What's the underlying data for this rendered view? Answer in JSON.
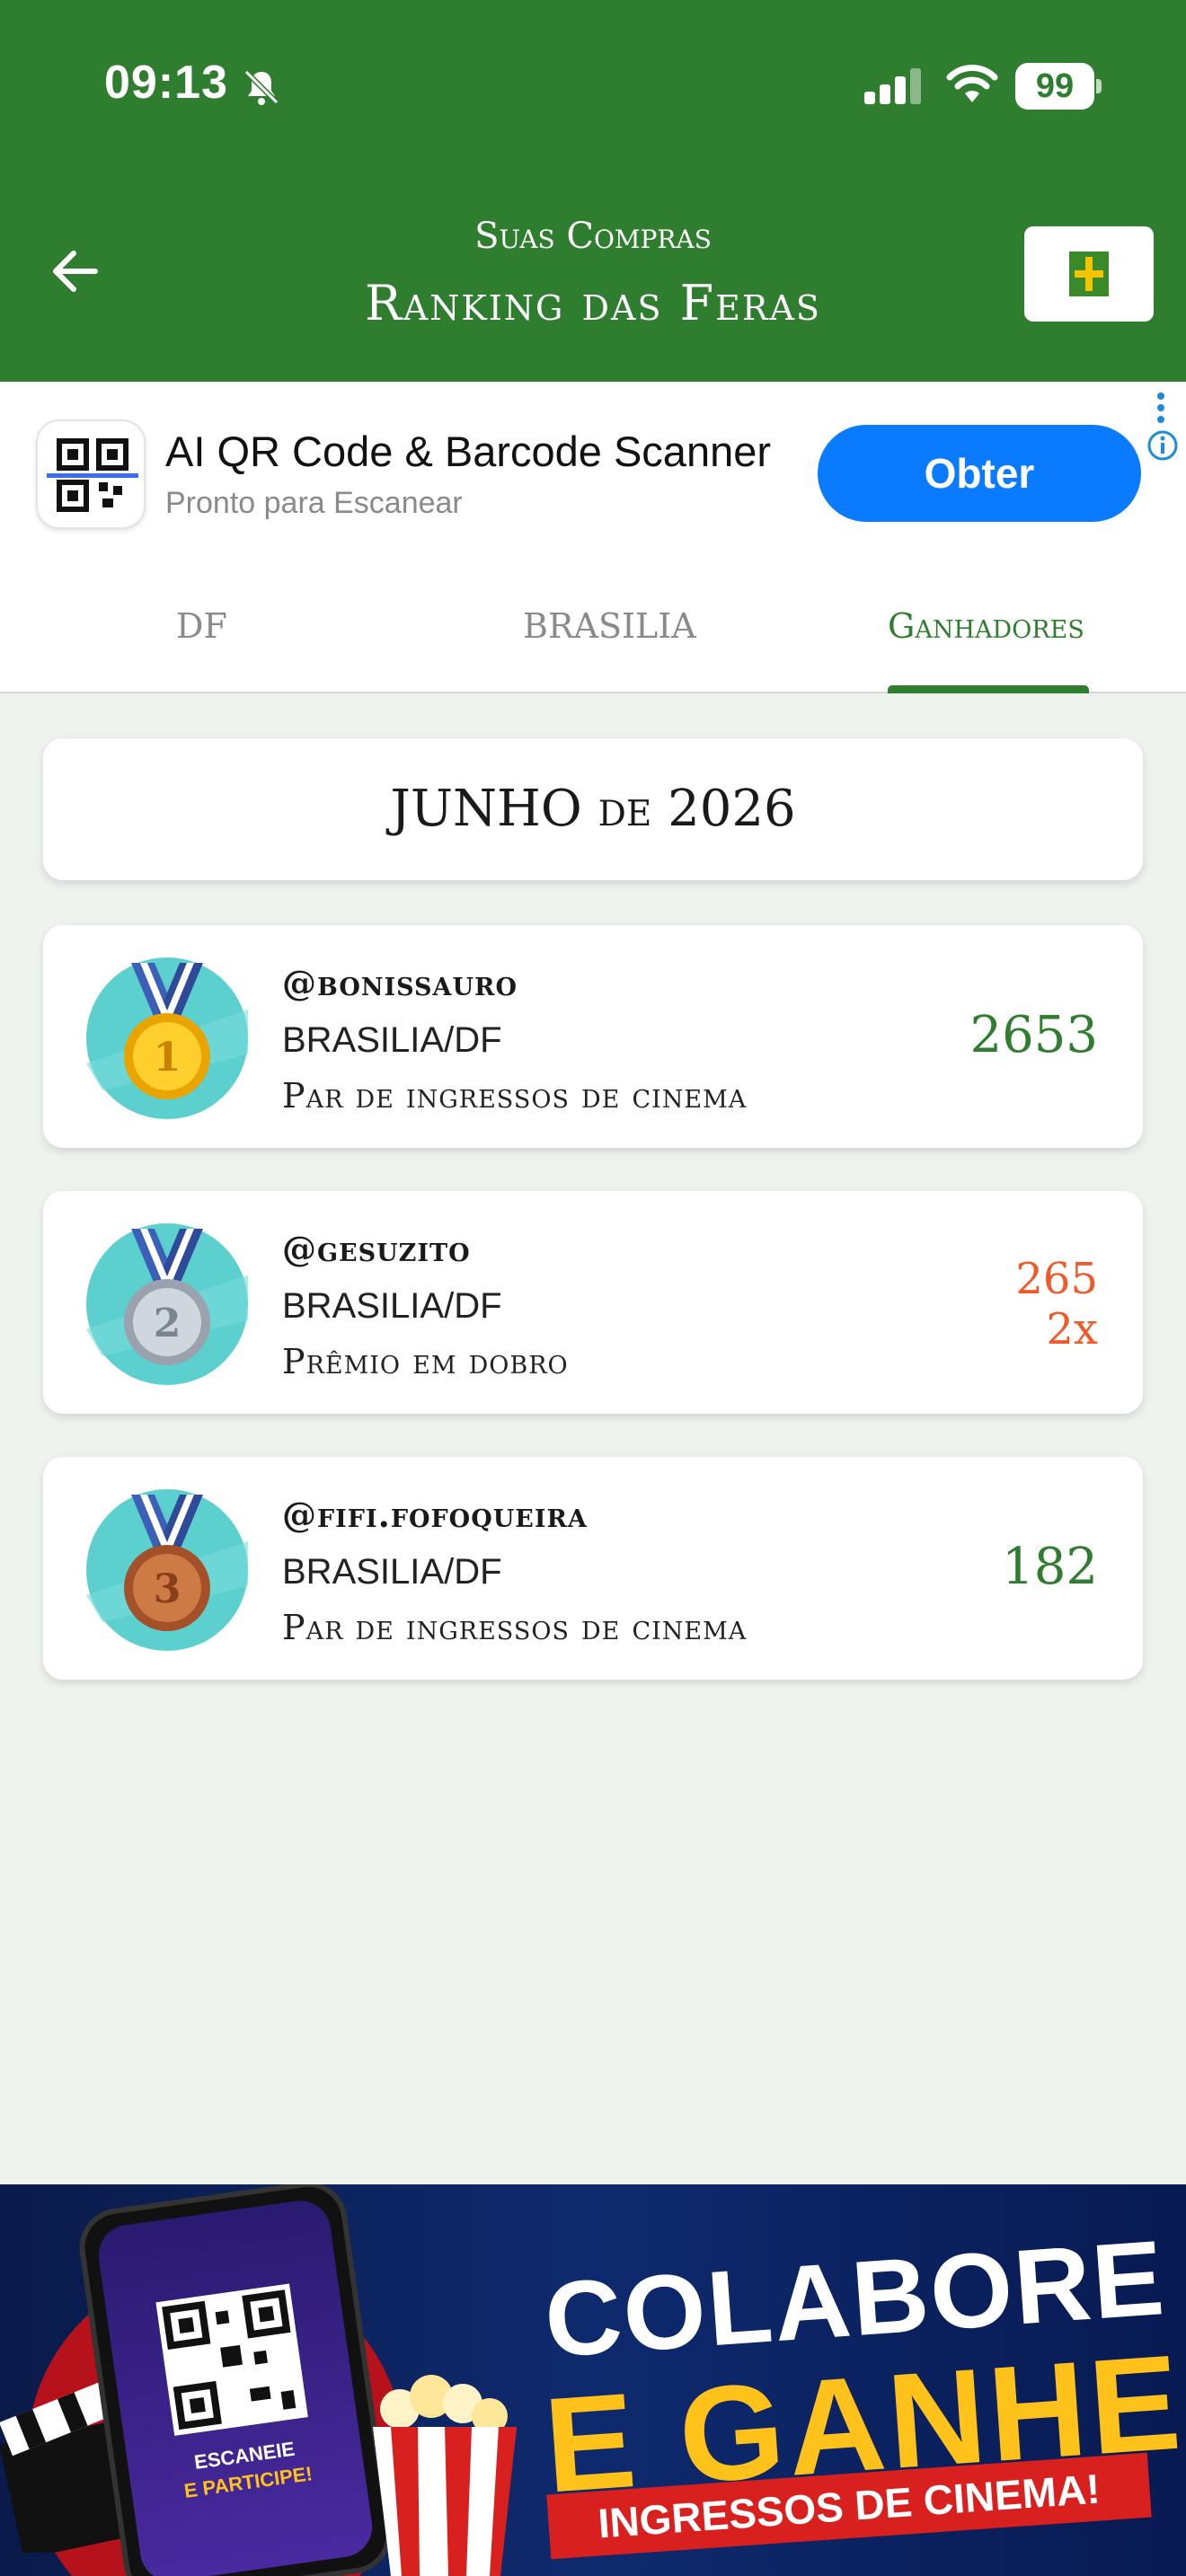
{
  "status_bar": {
    "time": "09:13",
    "battery": "99"
  },
  "header": {
    "subtitle": "Suas Compras",
    "title": "Ranking das Feras"
  },
  "ad": {
    "title": "AI QR Code & Barcode Scanner",
    "subtitle": "Pronto para Escanear",
    "button": "Obter"
  },
  "tabs": [
    {
      "label": "DF"
    },
    {
      "label": "BRASILIA"
    },
    {
      "label": "Ganhadores"
    }
  ],
  "month": "JUNHO de 2026",
  "winners": [
    {
      "user": "@bonissauro",
      "city": "BRASILIA/DF",
      "prize": "Par de ingressos de cinema",
      "score": "2653",
      "medal": "1"
    },
    {
      "user": "@gesuzito",
      "city": "BRASILIA/DF",
      "prize": "Prêmio em dobro",
      "score": "265",
      "multiplier": "2x",
      "medal": "2"
    },
    {
      "user": "@fifi.fofoqueira",
      "city": "BRASILIA/DF",
      "prize": "Par de ingressos de cinema",
      "score": "182",
      "medal": "3"
    }
  ],
  "banner": {
    "line1": "COLABORE",
    "line2": "E GANHE",
    "ribbon": "INGRESSOS DE CINEMA!",
    "phone_line1": "ESCANEIE",
    "phone_line2": "E PARTICIPE!"
  },
  "colors": {
    "primary": "#2f7d2f",
    "accent": "#f05a28",
    "ad_button": "#0a7bff"
  }
}
